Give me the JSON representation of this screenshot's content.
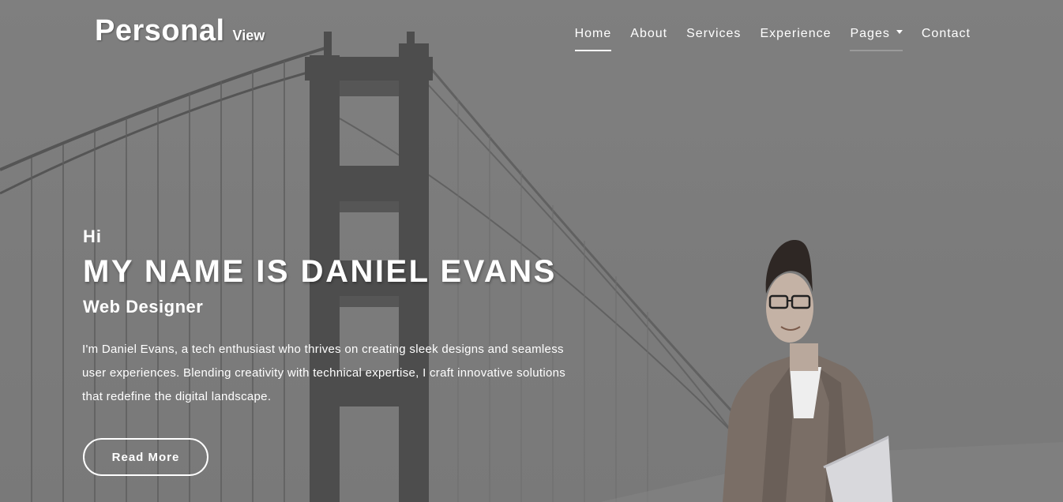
{
  "brand": {
    "main": "Personal",
    "sub": "View"
  },
  "nav": {
    "items": [
      {
        "label": "Home"
      },
      {
        "label": "About"
      },
      {
        "label": "Services"
      },
      {
        "label": "Experience"
      },
      {
        "label": "Pages"
      },
      {
        "label": "Contact"
      }
    ],
    "active": "Home"
  },
  "hero": {
    "greeting": "Hi",
    "headline": "MY NAME IS DANIEL EVANS",
    "role": "Web Designer",
    "bio": "I'm Daniel Evans, a tech enthusiast who thrives on creating sleek designs and seamless user experiences. Blending creativity with technical expertise, I craft innovative solutions that redefine the digital landscape.",
    "cta_label": "Read More"
  },
  "icons": {
    "pages_dropdown": "caret-down-icon"
  },
  "colors": {
    "text": "#ffffff",
    "background": "#7d7d7d",
    "bridge": "#3c3c3c"
  }
}
